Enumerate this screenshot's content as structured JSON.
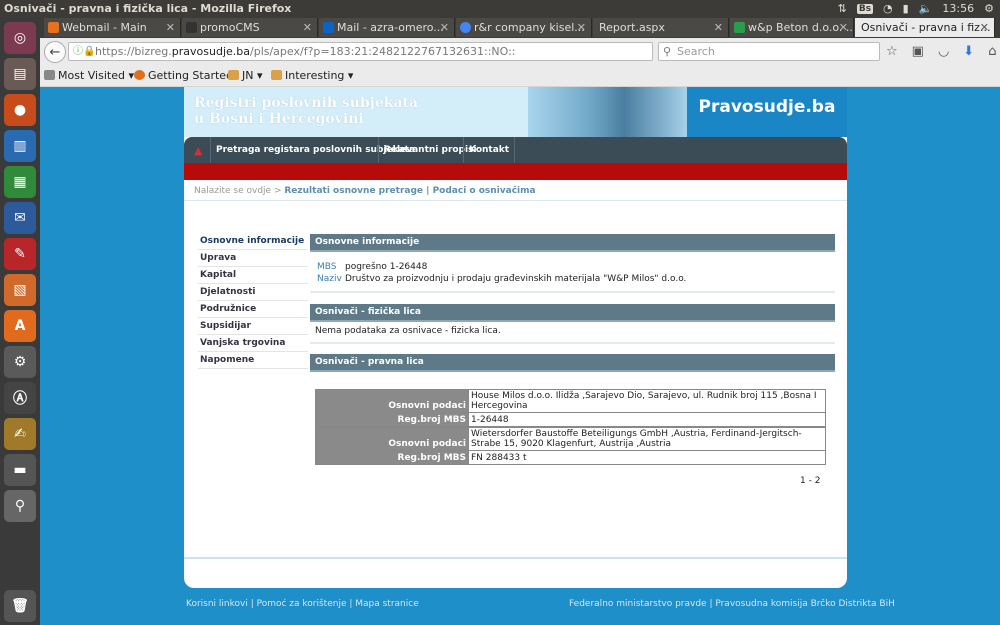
{
  "window": {
    "title": "Osnivači - pravna i fizička lica - Mozilla Firefox",
    "time": "13:56",
    "kb": "Bs"
  },
  "tabs": [
    {
      "label": "Webmail - Main",
      "color": "#e8711c"
    },
    {
      "label": "promoCMS",
      "color": "#333333"
    },
    {
      "label": "Mail - azra-omero...",
      "color": "#0a64c8"
    },
    {
      "label": "r&r company kisel...",
      "color": "#4285f4"
    },
    {
      "label": "Report.aspx",
      "color": ""
    },
    {
      "label": "w&p Beton d.o.o. ...",
      "color": "#2a9d4a"
    },
    {
      "label": "Osnivači - pravna i fiz...",
      "color": ""
    }
  ],
  "nav": {
    "url_prefix": "https://bizreg.",
    "url_domain": "pravosudje.ba",
    "url_rest": "/pls/apex/f?p=183:21:2482122767132631::NO::",
    "search_placeholder": "Search"
  },
  "bookmarks": [
    "Most Visited",
    "Getting Started",
    "JN",
    "Interesting"
  ],
  "site": {
    "banner_line1": "Registri poslovnih subjekata",
    "banner_line2": "u Bosni i Hercegovini",
    "logo": "Pravosudje.ba",
    "menu": [
      "Pretraga registara poslovnih subjekata",
      "Relevantni propisi",
      "Kontakt"
    ],
    "crumb_prefix": "Nalazite se ovdje >",
    "crumb_path": "Rezultati osnovne pretrage | Podaci o osnivačima",
    "leftnav": [
      "Osnovne informacije",
      "Uprava",
      "Kapital",
      "Djelatnosti",
      "Podružnice",
      "Supsidijar",
      "Vanjska trgovina",
      "Napomene"
    ],
    "sec_basic": "Osnovne informacije",
    "mbs_label": "MBS",
    "mbs_value": "pogrešno 1-26448",
    "naziv_label": "Naziv",
    "naziv_value": "Društvo za proizvodnju i prodaju građevinskih materijala \"W&P Milos\" d.o.o.",
    "sec_fiz": "Osnivači - fizička lica",
    "nodata": "Nema podataka za osnivace - fizicka lica.",
    "sec_prav": "Osnivači - pravna lica",
    "rows": [
      {
        "l1": "Osnovni podaci",
        "v1": "House Milos d.o.o. Ilidža ,Sarajevo Dio, Sarajevo, ul. Rudnik broj 115 ,Bosna I Hercegovina",
        "l2": "Reg.broj MBS",
        "v2": "1-26448"
      },
      {
        "l1": "Osnovni podaci",
        "v1": "Wietersdorfer Baustoffe Beteiligungs GmbH ,Austria, Ferdinand-Jergitsch-Strabe 15, 9020 Klagenfurt, Austrija ,Austria",
        "l2": "Reg.broj MBS",
        "v2": "FN 288433 t"
      }
    ],
    "pager": "1 - 2",
    "footer_left": "Korisni linkovi | Pomoć za korištenje | Mapa stranice",
    "footer_right": "Federalno ministarstvo pravde | Pravosudna komisija Brčko Distrikta BiH"
  }
}
